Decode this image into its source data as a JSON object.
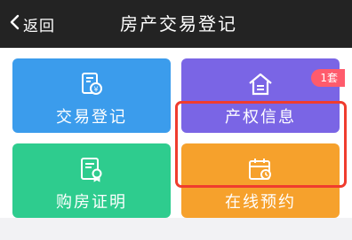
{
  "header": {
    "back_label": "返回",
    "title": "房产交易登记"
  },
  "tiles": [
    {
      "label": "交易登记",
      "icon": "transaction-doc-icon",
      "color": "#3b9cec"
    },
    {
      "label": "产权信息",
      "icon": "house-icon",
      "color": "#7a65e5",
      "badge": "1套",
      "highlighted": true
    },
    {
      "label": "购房证明",
      "icon": "certificate-icon",
      "color": "#2ecc8e"
    },
    {
      "label": "在线预约",
      "icon": "calendar-icon",
      "color": "#f6a12c"
    }
  ],
  "colors": {
    "header_bg": "#232323",
    "highlight_border": "#f03c2e",
    "badge_bg": "#ff5b6c"
  }
}
